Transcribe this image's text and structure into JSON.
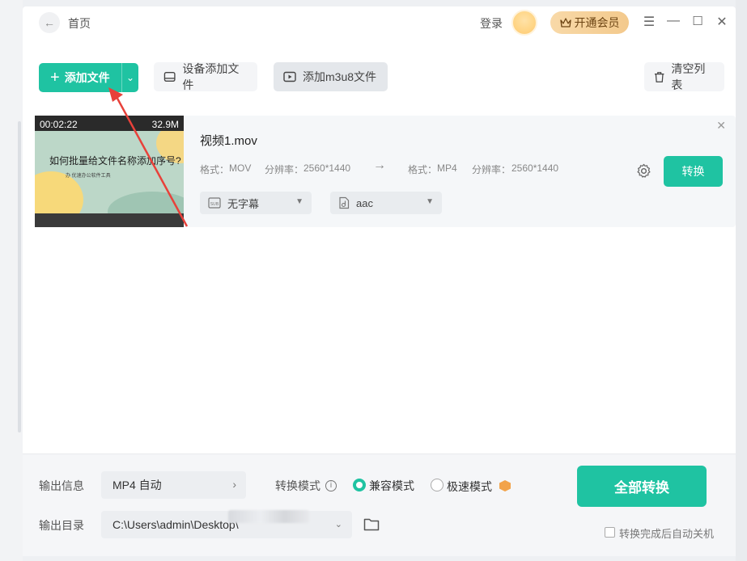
{
  "titlebar": {
    "back_icon": "arrow-left-icon",
    "title": "首页",
    "login": "登录",
    "vip": "开通会员",
    "menu_icon": "menu-icon",
    "minimize_icon": "minimize-icon",
    "maximize_icon": "maximize-icon",
    "close_icon": "close-icon"
  },
  "toolbar": {
    "add_file": "添加文件",
    "device_add": "设备添加文件",
    "add_m3u8": "添加m3u8文件",
    "clear_list": "清空列表"
  },
  "file": {
    "duration": "00:02:22",
    "size": "32.9M",
    "thumb_title": "如何批量给文件名称添加序号?",
    "thumb_sub": "办 优速办公软件工具",
    "name": "视频1.mov",
    "src_format_label": "格式：",
    "src_format": "MOV",
    "src_res_label": "分辨率：",
    "src_res": "2560*1440",
    "dst_format_label": "格式：",
    "dst_format": "MP4",
    "dst_res_label": "分辨率：",
    "dst_res": "2560*1440",
    "subtitle": "无字幕",
    "audio": "aac",
    "convert": "转换"
  },
  "footer": {
    "output_info_label": "输出信息",
    "output_info": "MP4 自动",
    "mode_label": "转换模式",
    "mode_compatible": "兼容模式",
    "mode_fast": "极速模式",
    "output_dir_label": "输出目录",
    "output_dir": "C:\\Users\\admin\\Desktop\\",
    "convert_all": "全部转换",
    "auto_shutdown": "转换完成后自动关机"
  },
  "colors": {
    "accent": "#1fc3a2",
    "vip": "#f3c98c",
    "annotation": "#e8413a"
  }
}
